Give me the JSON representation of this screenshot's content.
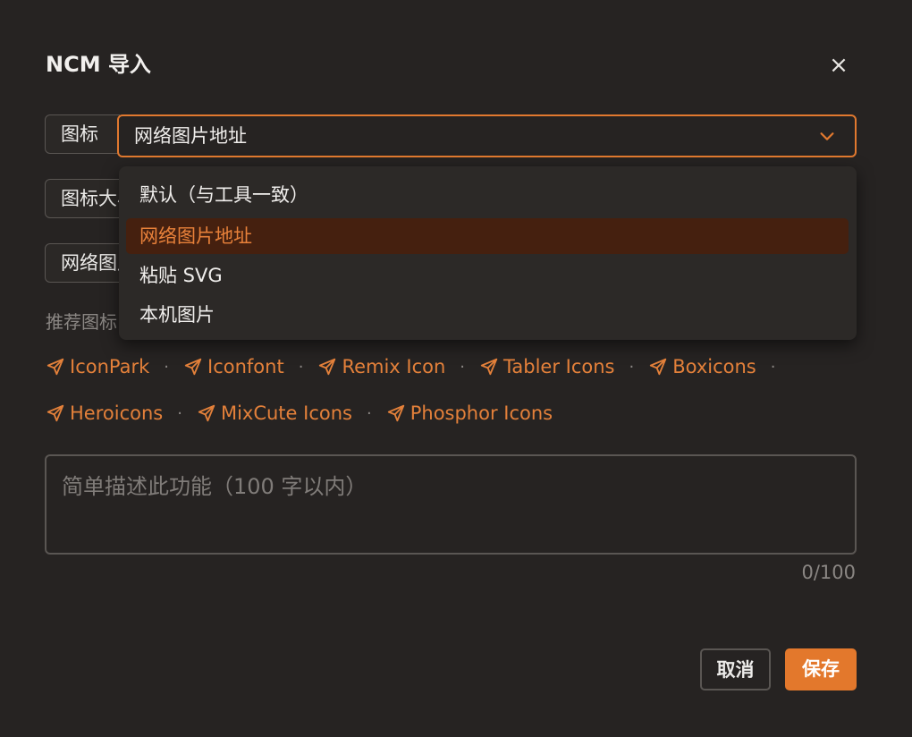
{
  "dialog": {
    "title": "NCM 导入",
    "close_icon": "×"
  },
  "form": {
    "icon_label": "图标",
    "icon_size_label": "图标大小",
    "network_image_label": "网络图片地址",
    "icon_select": {
      "value": "网络图片地址",
      "options": [
        {
          "label": "默认（与工具一致）",
          "selected": false
        },
        {
          "label": "网络图片地址",
          "selected": true
        },
        {
          "label": "粘贴 SVG",
          "selected": false
        },
        {
          "label": "本机图片",
          "selected": false
        }
      ]
    },
    "recommended_label": "推荐图标",
    "icon_sites": [
      {
        "label": "IconPark"
      },
      {
        "label": "Iconfont"
      },
      {
        "label": "Remix Icon"
      },
      {
        "label": "Tabler Icons"
      },
      {
        "label": "Boxicons"
      },
      {
        "label": "Heroicons"
      },
      {
        "label": "MixCute Icons"
      },
      {
        "label": "Phosphor Icons"
      }
    ],
    "separator": "·",
    "description": {
      "value": "",
      "placeholder": "简单描述此功能（100 字以内）",
      "counter": "0/100"
    }
  },
  "footer": {
    "cancel_label": "取消",
    "save_label": "保存"
  },
  "colors": {
    "accent": "#e3782c",
    "background": "#262322",
    "menu_active_bg": "#45200f"
  }
}
